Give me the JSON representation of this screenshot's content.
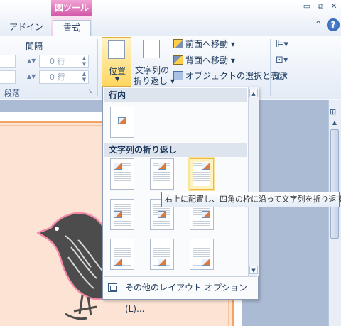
{
  "tabs": {
    "tool_context": "図ツール",
    "addin": "アドイン",
    "format": "書式"
  },
  "window": {
    "minimize": "▭",
    "restore": "⧉",
    "close": "✕",
    "ribbon_minimize": "⌃",
    "help": "?"
  },
  "ribbon": {
    "spacing_label": "間隔",
    "spacing_before": "0 行",
    "spacing_after": "0 行",
    "paragraph_group": "段落",
    "position_label": "位置",
    "wrap_label_1": "文字列の",
    "wrap_label_2": "折り返し ▾",
    "bring_forward": "前面へ移動 ▾",
    "send_backward": "背面へ移動 ▾",
    "selection_pane": "オブジェクトの選択と表示"
  },
  "dropdown": {
    "inline_header": "行内",
    "wrap_header": "文字列の折り返し",
    "more_options": "その他のレイアウト オプション(L)..."
  },
  "tooltip": {
    "text": "右上に配置し、四角の枠に沿って文字列を折り返す"
  }
}
